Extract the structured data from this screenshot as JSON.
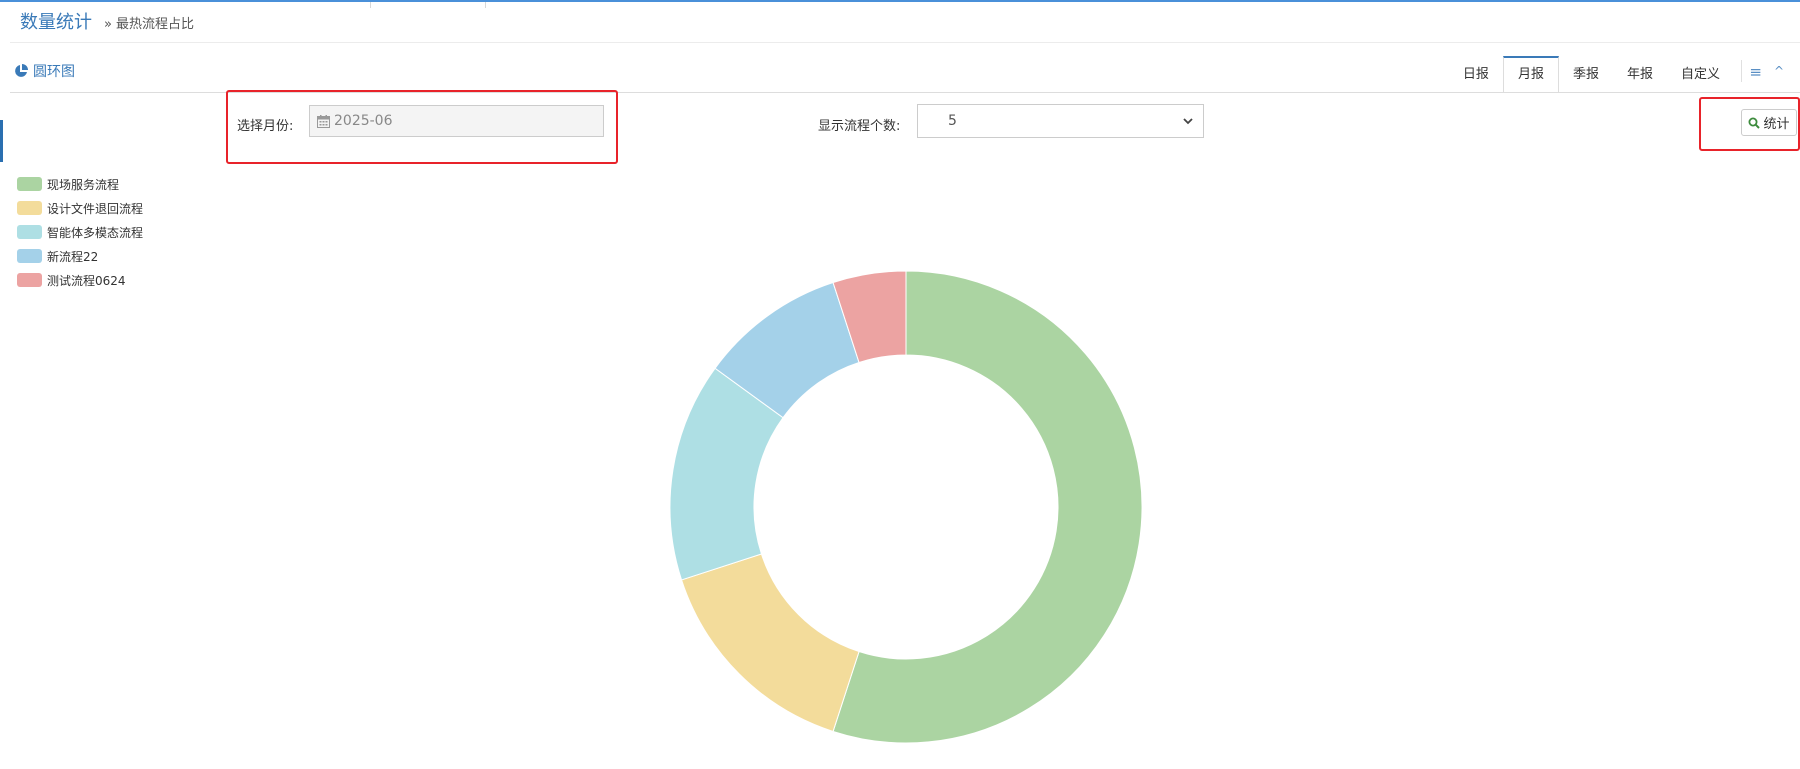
{
  "header": {
    "title": "数量统计",
    "breadcrumb_sep": "»",
    "breadcrumb": "最热流程占比"
  },
  "panel": {
    "title": "圆环图",
    "icon": "pie-chart-icon"
  },
  "tabs": [
    {
      "label": "日报",
      "active": false
    },
    {
      "label": "月报",
      "active": true
    },
    {
      "label": "季报",
      "active": false
    },
    {
      "label": "年报",
      "active": false
    },
    {
      "label": "自定义",
      "active": false
    }
  ],
  "toolbar_icons": {
    "menu": "≡",
    "collapse": "^"
  },
  "filters": {
    "month_label": "选择月份:",
    "month_value": "2025-06",
    "count_label": "显示流程个数:",
    "count_value": "5",
    "submit_label": "统计"
  },
  "colors": {
    "accent": "#3a7ab8",
    "highlight": "#e8232a"
  },
  "chart_data": {
    "type": "pie",
    "variant": "donut",
    "series": [
      {
        "name": "现场服务流程",
        "value": 55,
        "color": "#abd4a2"
      },
      {
        "name": "设计文件退回流程",
        "value": 15,
        "color": "#f3dc9b"
      },
      {
        "name": "智能体多模态流程",
        "value": 15,
        "color": "#aedfe4"
      },
      {
        "name": "新流程22",
        "value": 10,
        "color": "#a4d1e9"
      },
      {
        "name": "测试流程0624",
        "value": 5,
        "color": "#eca3a2"
      }
    ],
    "legend_position": "top-left"
  }
}
